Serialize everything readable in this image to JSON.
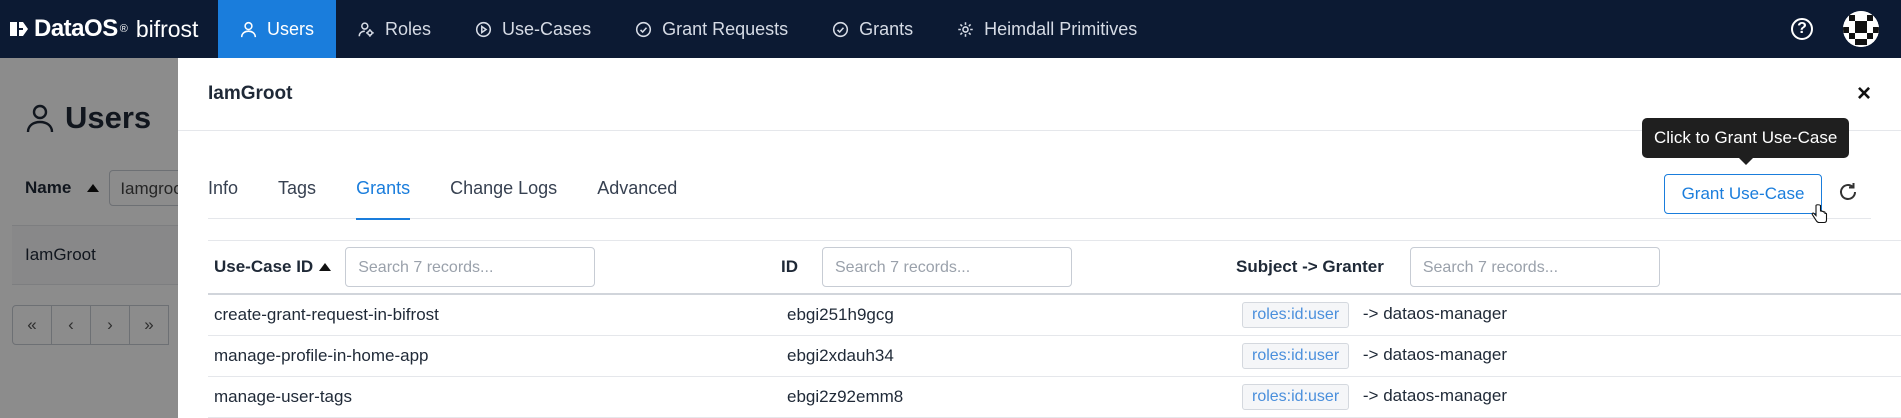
{
  "brand": {
    "name": "DataOS",
    "reg": "®",
    "app": "bifrost"
  },
  "nav": [
    {
      "label": "Users",
      "icon": "user-icon",
      "active": true
    },
    {
      "label": "Roles",
      "icon": "roles-icon",
      "active": false
    },
    {
      "label": "Use-Cases",
      "icon": "play-circle-icon",
      "active": false
    },
    {
      "label": "Grant Requests",
      "icon": "check-circle-icon",
      "active": false
    },
    {
      "label": "Grants",
      "icon": "check-circle-icon",
      "active": false
    },
    {
      "label": "Heimdall Primitives",
      "icon": "gear-icon",
      "active": false
    }
  ],
  "header_right": {
    "help": "?"
  },
  "background_page": {
    "title": "Users",
    "filter_label": "Name",
    "filter_value": "Iamgroo",
    "row_name": "IamGroot",
    "pager": [
      "«",
      "‹",
      "›",
      "»"
    ]
  },
  "drawer": {
    "title": "IamGroot",
    "close": "×",
    "tabs": [
      "Info",
      "Tags",
      "Grants",
      "Change Logs",
      "Advanced"
    ],
    "active_tab": "Grants",
    "grant_button": "Grant Use-Case",
    "tooltip": "Click to Grant Use-Case",
    "table": {
      "columns": [
        {
          "label": "Use-Case ID",
          "placeholder": "Search 7 records..."
        },
        {
          "label": "ID",
          "placeholder": "Search 7 records..."
        },
        {
          "label": "Subject -> Granter",
          "placeholder": "Search 7 records..."
        }
      ],
      "rows": [
        {
          "use_case": "create-grant-request-in-bifrost",
          "id": "ebgi251h9gcg",
          "subject": "roles:id:user",
          "granter": "-> dataos-manager"
        },
        {
          "use_case": "manage-profile-in-home-app",
          "id": "ebgi2xdauh34",
          "subject": "roles:id:user",
          "granter": "-> dataos-manager"
        },
        {
          "use_case": "manage-user-tags",
          "id": "ebgi2z92emm8",
          "subject": "roles:id:user",
          "granter": "-> dataos-manager"
        }
      ]
    }
  },
  "colors": {
    "nav_bg": "#0c1a33",
    "accent": "#1a7ddc",
    "tag_text": "#4a8fdc"
  }
}
